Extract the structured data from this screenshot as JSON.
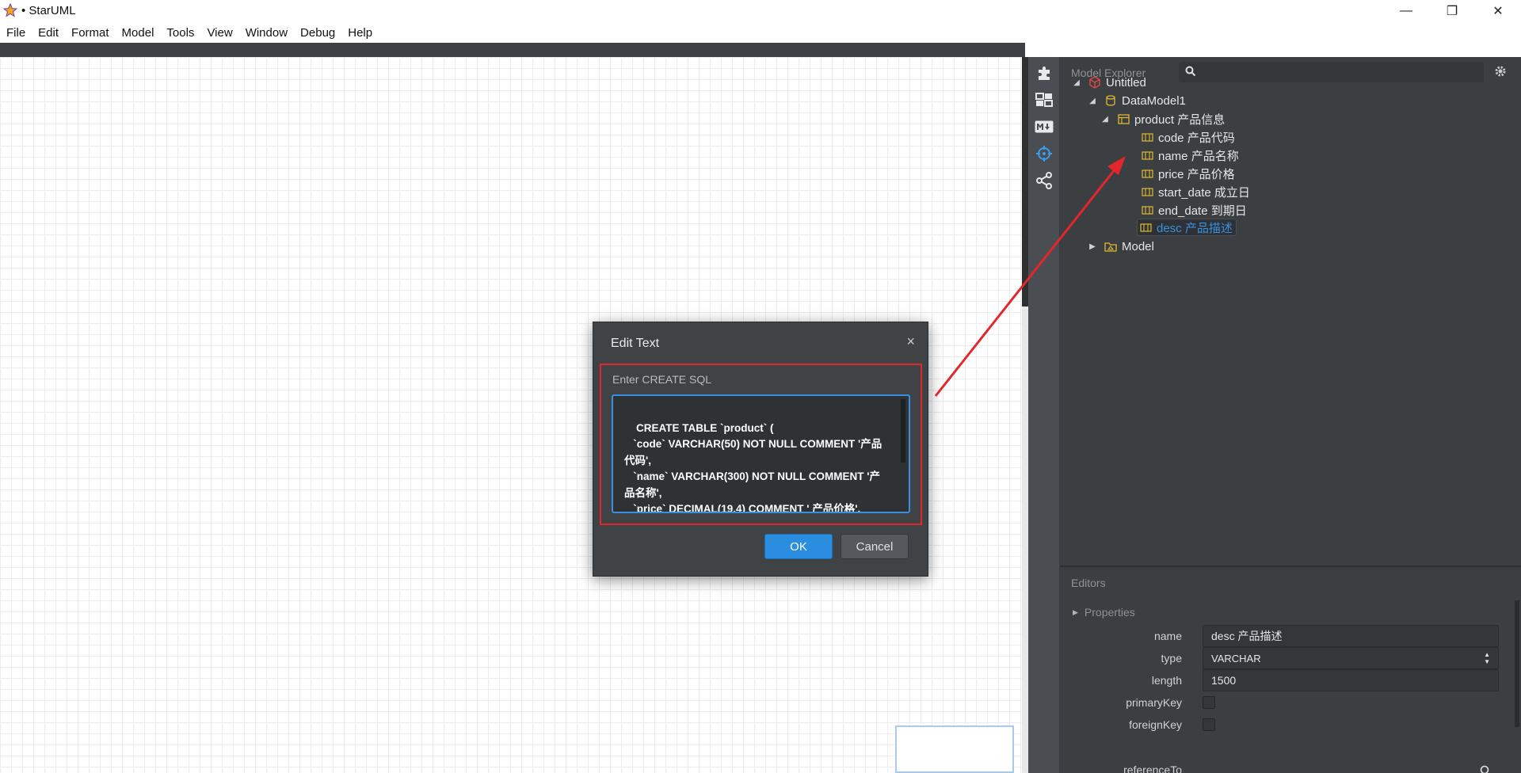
{
  "window": {
    "title": "• StarUML",
    "controls": [
      "—",
      "❐",
      "✕"
    ]
  },
  "menu": [
    "File",
    "Edit",
    "Format",
    "Model",
    "Tools",
    "View",
    "Window",
    "Debug",
    "Help"
  ],
  "explorer": {
    "header": "Model Explorer",
    "search_placeholder": "",
    "tree": {
      "root": "Untitled",
      "datamodel": "DataModel1",
      "table": "product 产品信息",
      "columns": [
        "code 产品代码",
        "name 产品名称",
        "price 产品价格",
        "start_date 成立日",
        "end_date 到期日",
        "desc 产品描述"
      ],
      "selected_column_index": 5,
      "model": "Model"
    }
  },
  "editors": {
    "header": "Editors",
    "section": "Properties",
    "props": {
      "name_label": "name",
      "name_value": "desc 产品描述",
      "type_label": "type",
      "type_value": "VARCHAR",
      "length_label": "length",
      "length_value": "1500",
      "primaryKey_label": "primaryKey",
      "foreignKey_label": "foreignKey",
      "referenceTo_label": "referenceTo"
    }
  },
  "dialog": {
    "title": "Edit Text",
    "close": "×",
    "label": "Enter CREATE SQL",
    "sql": "CREATE TABLE `product` (\n   `code` VARCHAR(50) NOT NULL COMMENT '产品代码',\n   `name` VARCHAR(300) NOT NULL COMMENT '产品名称',\n   `price` DECIMAL(19,4) COMMENT ' 产品价格',\n   `start_date` date COMMENT '成立日',",
    "ok": "OK",
    "cancel": "Cancel"
  },
  "colors": {
    "accent": "#2b8de0",
    "annotation_red": "#e2262b",
    "panel_bg": "#3b3f42",
    "selected_text": "#3a8fde"
  }
}
